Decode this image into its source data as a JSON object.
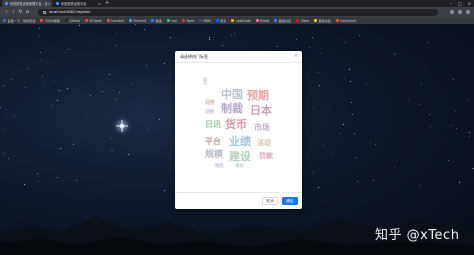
{
  "browser": {
    "tabs": [
      {
        "label": "系统报表运营管理平台 - 总控"
      },
      {
        "label": "系统报表运营平台"
      }
    ],
    "new_tab": "+",
    "url": "localhost:8082/register",
    "bookmarks": [
      {
        "label": "百度一下，你就知道",
        "color": "#3b6de0"
      },
      {
        "label": "CSDN博客",
        "color": "#e84b3a"
      },
      {
        "label": "GitHub",
        "color": "#24292e"
      },
      {
        "label": "ECharts",
        "color": "#d94c3b"
      },
      {
        "label": "Iconfont",
        "color": "#e0475b"
      },
      {
        "label": "Element",
        "color": "#409eff"
      },
      {
        "label": "掘金",
        "color": "#1e80ff"
      },
      {
        "label": "Vue",
        "color": "#42b883"
      },
      {
        "label": "Npm",
        "color": "#cb3837"
      },
      {
        "label": "MDN",
        "color": "#2f4f7f"
      },
      {
        "label": "知乎",
        "color": "#0066ff"
      },
      {
        "label": "LeetCode",
        "color": "#f2a33c"
      },
      {
        "label": "Bilibili",
        "color": "#fb7299"
      },
      {
        "label": "掘金社区",
        "color": "#1e80ff"
      },
      {
        "label": "Gitee",
        "color": "#c71d23"
      },
      {
        "label": "其他书签",
        "color": "#f0c040"
      },
      {
        "label": "EasyExcel",
        "color": "#e85a2c"
      }
    ]
  },
  "modal": {
    "title": "请选择热门标签",
    "close_icon": "close-icon",
    "cancel_label": "取消",
    "ok_label": "确定"
  },
  "wordcloud": [
    {
      "text": "中国",
      "color": "#b7c3cf"
    },
    {
      "text": "预期",
      "color": "#e2a6a6"
    },
    {
      "text": "小时",
      "color": "#bfc8d6"
    },
    {
      "text": "局势",
      "color": "#d4b8a8"
    },
    {
      "text": "制裁",
      "color": "#b5a9c9"
    },
    {
      "text": "日本",
      "color": "#c9a3b9"
    },
    {
      "text": "调整",
      "color": "#c5cfd8"
    },
    {
      "text": "货币",
      "color": "#d99aa6"
    },
    {
      "text": "日讯",
      "color": "#9ec9a8"
    },
    {
      "text": "市场",
      "color": "#c2aed0"
    },
    {
      "text": "业绩",
      "color": "#a8c5d8"
    },
    {
      "text": "平台",
      "color": "#c7a3a3"
    },
    {
      "text": "活动",
      "color": "#d2c0a5"
    },
    {
      "text": "规模",
      "color": "#b8bcc8"
    },
    {
      "text": "建设",
      "color": "#b6d0c0"
    },
    {
      "text": "罚款",
      "color": "#d8a9b5"
    },
    {
      "text": "地区",
      "color": "#c8b8d8"
    },
    {
      "text": "增长",
      "color": "#c0d0c8"
    }
  ],
  "watermark": "知乎 @xTech"
}
